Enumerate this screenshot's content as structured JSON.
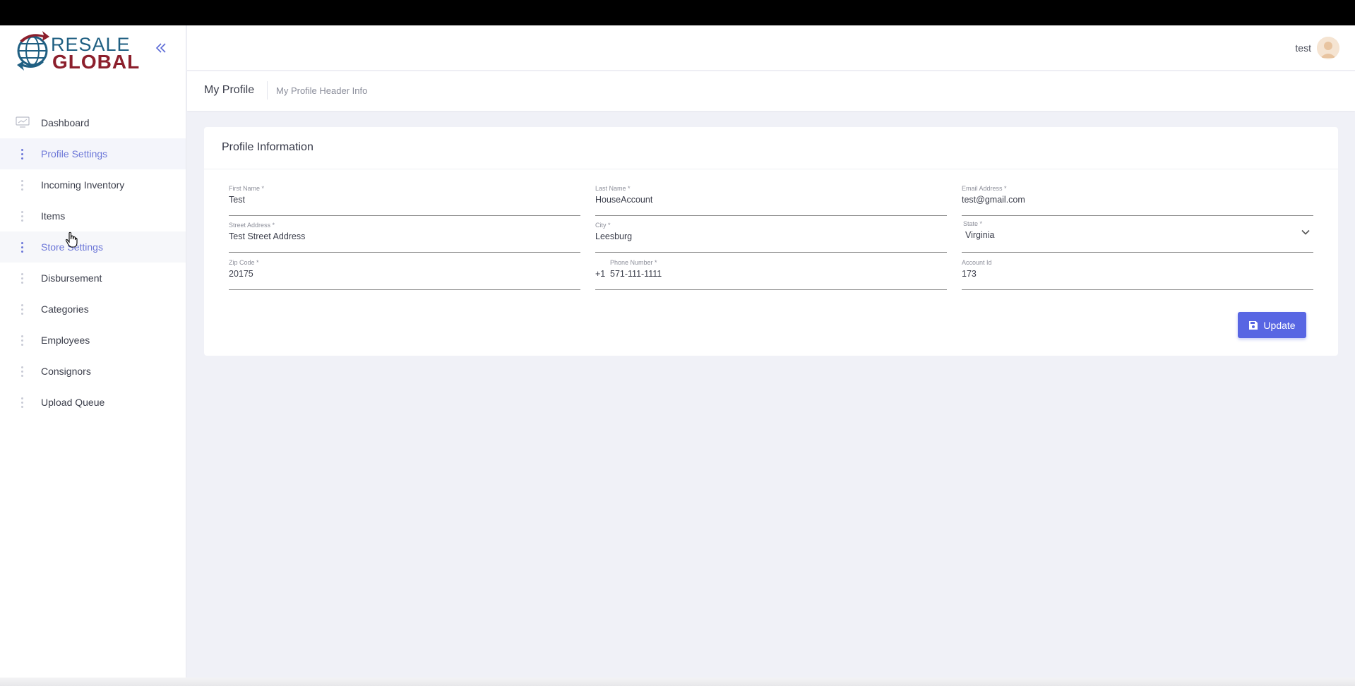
{
  "brand": {
    "line1": "RESALE",
    "line2": "GLOBAL"
  },
  "header": {
    "user_name": "test"
  },
  "subheader": {
    "title": "My Profile",
    "subtitle": "My Profile Header Info"
  },
  "sidebar": {
    "items": [
      {
        "label": "Dashboard",
        "icon": "monitor-icon"
      },
      {
        "label": "Profile Settings"
      },
      {
        "label": "Incoming Inventory"
      },
      {
        "label": "Items"
      },
      {
        "label": "Store Settings"
      },
      {
        "label": "Disbursement"
      },
      {
        "label": "Categories"
      },
      {
        "label": "Employees"
      },
      {
        "label": "Consignors"
      },
      {
        "label": "Upload Queue"
      }
    ]
  },
  "card": {
    "title": "Profile Information",
    "fields": {
      "first_name": {
        "label": "First Name *",
        "value": "Test"
      },
      "last_name": {
        "label": "Last Name *",
        "value": "HouseAccount"
      },
      "email": {
        "label": "Email Address *",
        "value": "test@gmail.com"
      },
      "street": {
        "label": "Street Address *",
        "value": "Test Street Address"
      },
      "city": {
        "label": "City *",
        "value": "Leesburg"
      },
      "state": {
        "label": "State *",
        "value": "Virginia"
      },
      "zip": {
        "label": "Zip Code *",
        "value": "20175"
      },
      "phone": {
        "label": "Phone Number *",
        "prefix": "+1",
        "value": "571-111-1111"
      },
      "account_id": {
        "label": "Account Id",
        "value": "173"
      }
    },
    "update_label": "Update"
  },
  "colors": {
    "accent": "#5866e3",
    "brand_blue": "#1f5f82",
    "brand_red": "#8c1f2c"
  }
}
